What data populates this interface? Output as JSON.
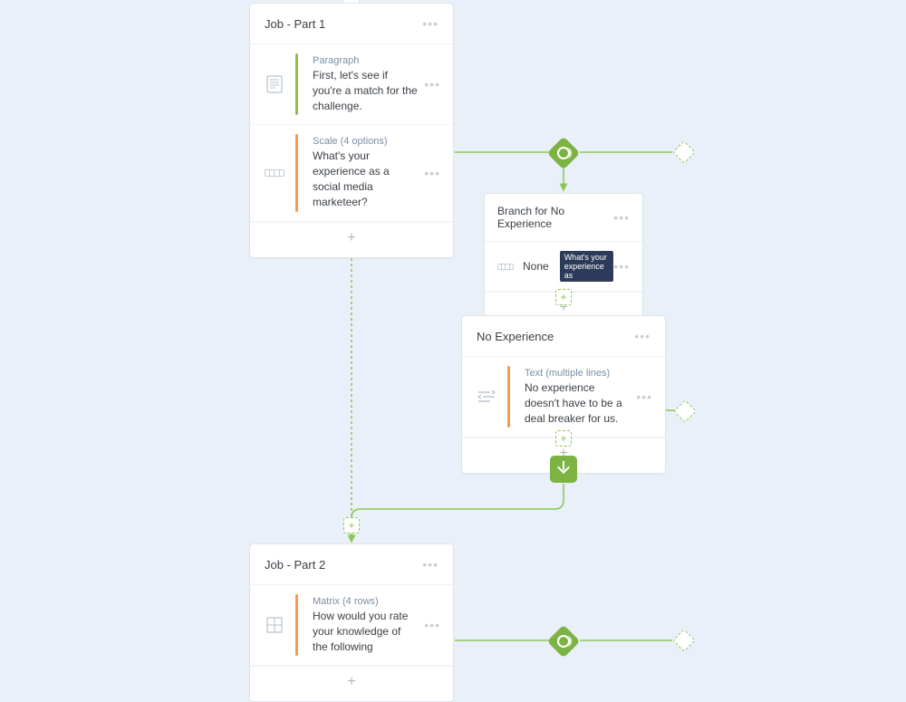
{
  "cards": {
    "job1": {
      "title": "Job - Part 1",
      "rows": [
        {
          "type": "Paragraph",
          "text": "First, let's see if you're a match for the challenge."
        },
        {
          "type": "Scale (4 options)",
          "text": "What's your experience as a social media marketeer?"
        }
      ]
    },
    "branch": {
      "title": "Branch for No Experience",
      "condition": {
        "label": "None",
        "tag": "What's your experience as"
      }
    },
    "noexp": {
      "title": "No Experience",
      "rows": [
        {
          "type": "Text (multiple lines)",
          "text": "No experience doesn't have to be a deal breaker for us."
        }
      ]
    },
    "job2": {
      "title": "Job - Part 2",
      "rows": [
        {
          "type": "Matrix (4 rows)",
          "text": "How would you rate your knowledge of the following"
        }
      ]
    }
  }
}
